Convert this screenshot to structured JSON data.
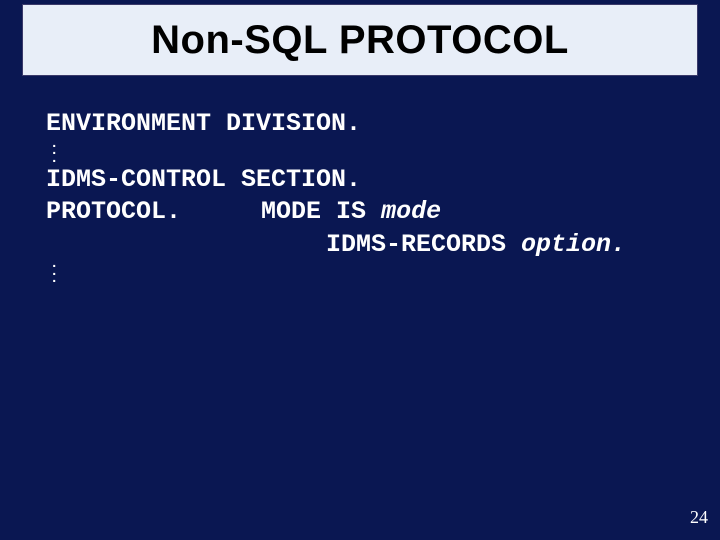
{
  "title": "Non-SQL PROTOCOL",
  "lines": {
    "env_div": "ENVIRONMENT DIVISION.",
    "idms_ctrl": "IDMS-CONTROL SECTION.",
    "protocol": "PROTOCOL.",
    "mode_is": "MODE IS ",
    "mode_var": "mode",
    "idms_rec": "IDMS-RECORDS ",
    "option_var": "option.",
    "dot": "."
  },
  "page_number": "24"
}
